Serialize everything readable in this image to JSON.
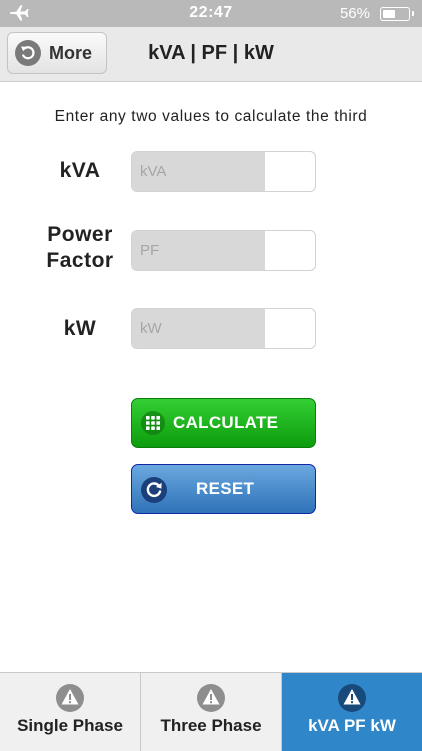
{
  "status_bar": {
    "time": "22:47",
    "battery_text": "56%",
    "battery_level": 0.56
  },
  "nav": {
    "back_label": "More",
    "title": "kVA | PF | kW"
  },
  "main": {
    "instruction": "Enter any two values to calculate the third",
    "fields": [
      {
        "label": "kVA",
        "placeholder": "kVA",
        "value": ""
      },
      {
        "label_line1": "Power",
        "label_line2": "Factor",
        "placeholder": "PF",
        "value": ""
      },
      {
        "label": "kW",
        "placeholder": "kW",
        "value": ""
      }
    ],
    "calculate_label": "CALCULATE",
    "reset_label": "RESET"
  },
  "tabs": [
    {
      "label": "Single Phase",
      "icon": "warning-icon",
      "selected": false
    },
    {
      "label": "Three Phase",
      "icon": "warning-icon",
      "selected": false
    },
    {
      "label": "kVA PF kW",
      "icon": "warning-icon",
      "selected": true
    }
  ],
  "colors": {
    "calculate": "#1db51d",
    "reset": "#4a8fd0",
    "selected_tab": "#2f86c9",
    "status_bar": "#b9b9b9"
  }
}
